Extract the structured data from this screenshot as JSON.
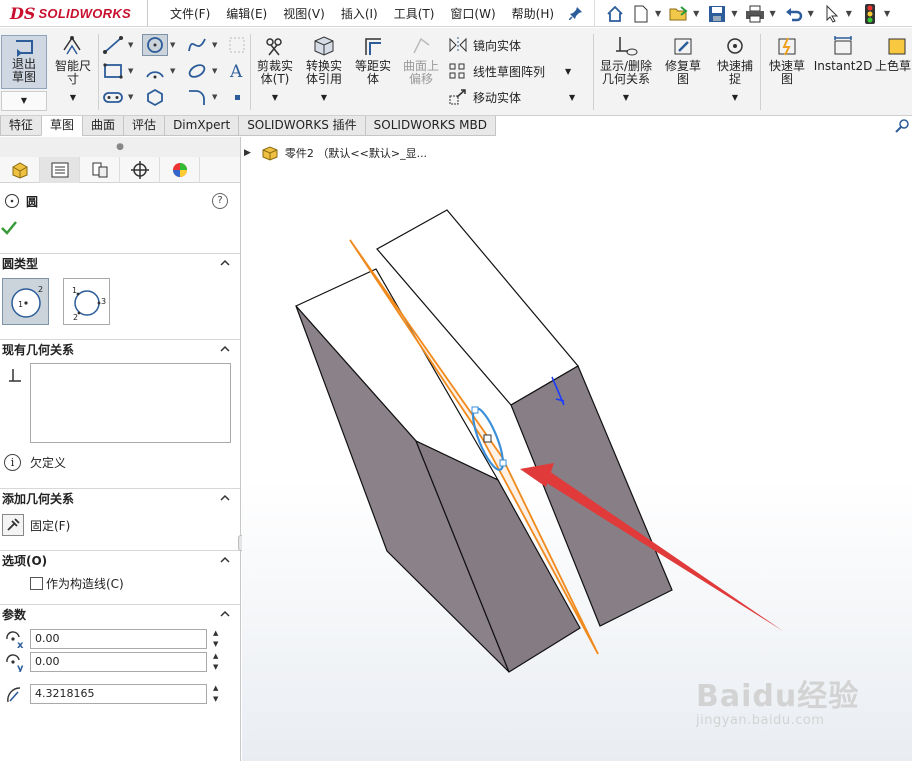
{
  "app": {
    "logo_mark": "DS",
    "logo_text": "SOLIDWORKS"
  },
  "menu": [
    "文件(F)",
    "编辑(E)",
    "视图(V)",
    "插入(I)",
    "工具(T)",
    "窗口(W)",
    "帮助(H)"
  ],
  "commands": {
    "exit_sketch": "退出草图",
    "smart_dim": "智能尺寸",
    "trim": "剪裁实体(T)",
    "convert": "转换实体引用",
    "offset": "等距实体",
    "surface_offset": "曲面上偏移",
    "mirror": "镜向实体",
    "linear_pattern": "线性草图阵列",
    "move": "移动实体",
    "relations": "显示/删除几何关系",
    "repair": "修复草图",
    "quick_snap": "快速捕捉",
    "rapid_sketch": "快速草图",
    "instant2d": "Instant2D",
    "shaded": "上色草图轮廓"
  },
  "tabs": [
    "特征",
    "草图",
    "曲面",
    "评估",
    "DimXpert",
    "SOLIDWORKS 插件",
    "SOLIDWORKS MBD"
  ],
  "active_tab": "草图",
  "pm": {
    "title": "圆",
    "help": "?",
    "section_circle_type": "圆类型",
    "section_existing": "现有几何关系",
    "status": "欠定义",
    "section_add": "添加几何关系",
    "fix_label": "固定(F)",
    "section_options": "选项(O)",
    "construction": "作为构造线(C)",
    "section_params": "参数",
    "cx": "0.00",
    "cy": "0.00",
    "radius": "4.3218165"
  },
  "tree": {
    "label": "零件2 （默认<<默认>_显..."
  },
  "watermark": {
    "main": "Baidu经验",
    "sub": "jingyan.baidu.com"
  },
  "colors": {
    "accent": "#c8102e",
    "sketch": "#f08a1c",
    "circle": "#3a8fd8",
    "arrow": "#e03a3a",
    "body": "#8b8289"
  }
}
